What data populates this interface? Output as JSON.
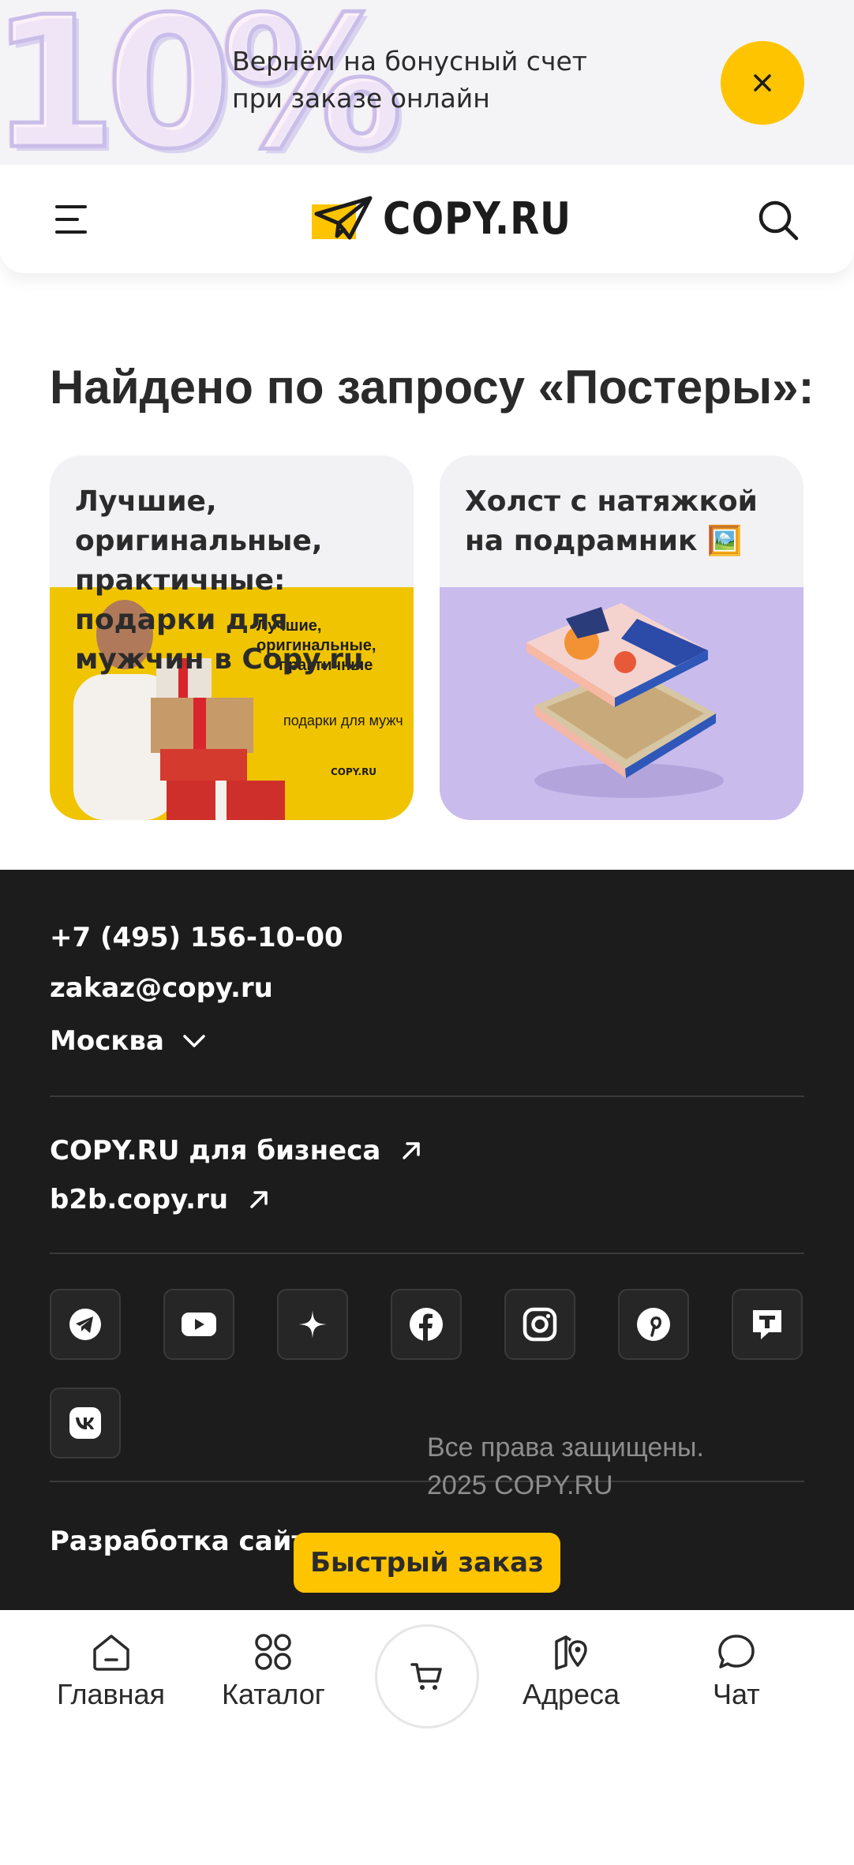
{
  "promo": {
    "big_text": "10%",
    "text_line1": "Вернём на бонусный счет",
    "text_line2": "при заказе онлайн",
    "close_icon": "close-icon",
    "accent": "#ffc400"
  },
  "header": {
    "menu_icon": "menu-icon",
    "logo_text": "COPY.RU",
    "search_icon": "search-icon"
  },
  "results": {
    "title": "Найдено по запросу «Постеры»:",
    "cards": [
      {
        "title": "Лучшие, оригинальные, практичные: подарки для мужчин в Copy.ru",
        "image_lines": [
          "Лучшие,",
          "оригинальные,",
          "практичные",
          "подарки для мужч"
        ],
        "image_logo": "COPY.RU"
      },
      {
        "title": "Холст с натяжкой на подрамник 🖼️"
      }
    ]
  },
  "footer": {
    "phone": "+7 (495) 156-10-00",
    "email": "zakaz@copy.ru",
    "city": "Москва",
    "business_link": "COPY.RU для бизнеса",
    "b2b_link": "b2b.copy.ru",
    "social": [
      "telegram-icon",
      "youtube-icon",
      "sparkle-icon",
      "facebook-icon",
      "instagram-icon",
      "pinterest-icon",
      "tenchat-icon",
      "vk-icon"
    ],
    "developer": "Разработка сайта",
    "rights_line1": "Все права защищены.",
    "rights_line2": "2025 COPY.RU",
    "quick_order": "Быстрый заказ"
  },
  "bottom_nav": {
    "home": "Главная",
    "catalog": "Каталог",
    "addresses": "Адреса",
    "chat": "Чат",
    "cart_icon": "cart-icon"
  }
}
